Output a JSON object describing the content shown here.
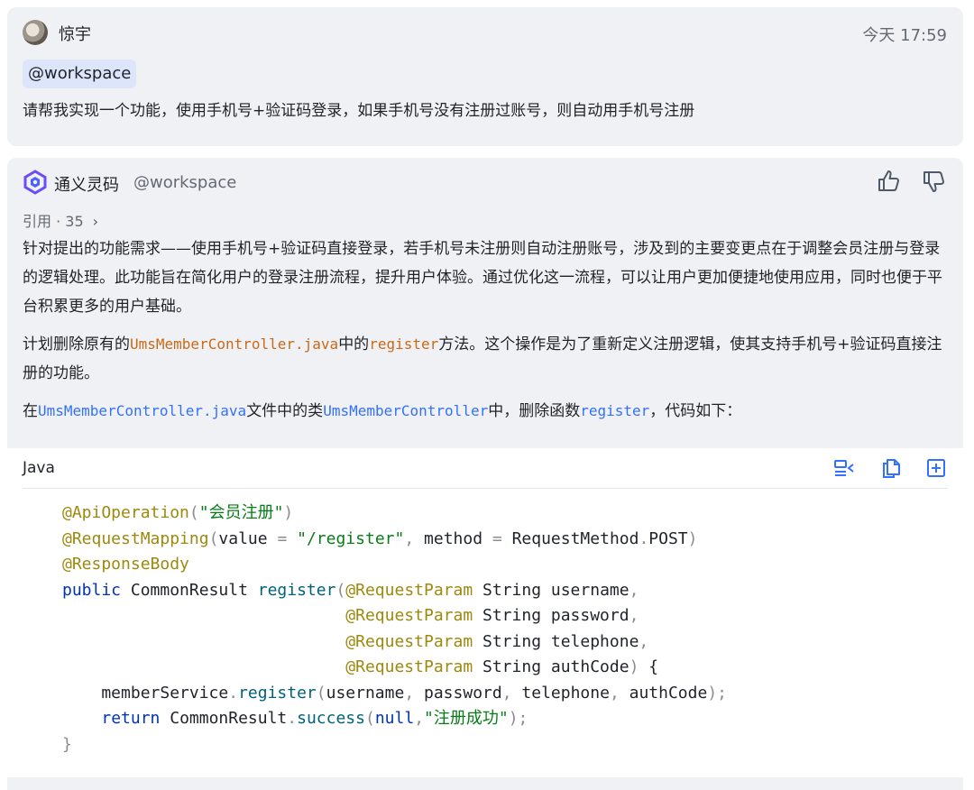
{
  "user_message": {
    "username": "惊宇",
    "time": "今天 17:59",
    "mention": "@workspace",
    "text": "请帮我实现一个功能，使用手机号+验证码登录，如果手机号没有注册过账号，则自动用手机号注册"
  },
  "ai_message": {
    "name": "通义灵码",
    "mention": "@workspace",
    "references": "引用 · 35",
    "paragraph1": "针对提出的功能需求——使用手机号+验证码直接登录，若手机号未注册则自动注册账号，涉及到的主要变更点在于调整会员注册与登录的逻辑处理。此功能旨在简化用户的登录注册流程，提升用户体验。通过优化这一流程，可以让用户更加便捷地使用应用，同时也便于平台积累更多的用户基础。",
    "paragraph2": {
      "t1": "计划删除原有的",
      "c1": "UmsMemberController.java",
      "t2": "中的",
      "c2": "register",
      "t3": "方法。这个操作是为了重新定义注册逻辑，使其支持手机号+验证码直接注册的功能。"
    },
    "paragraph3": {
      "t1": "在",
      "c1": "UmsMemberController.java",
      "t2": "文件中的类",
      "c2": "UmsMemberController",
      "t3": "中，删除函数",
      "c3": "register",
      "t4": "，代码如下："
    },
    "code_block": {
      "language": "Java",
      "lines": [
        "@ApiOperation(\"会员注册\")",
        "@RequestMapping(value = \"/register\", method = RequestMethod.POST)",
        "@ResponseBody",
        "public CommonResult register(@RequestParam String username,",
        "                            @RequestParam String password,",
        "                            @RequestParam String telephone,",
        "                            @RequestParam String authCode) {",
        "    memberService.register(username, password, telephone, authCode);",
        "    return CommonResult.success(null,\"注册成功\");",
        "}"
      ]
    }
  },
  "icons": {
    "avatar": "avatar",
    "ai_logo": "tongyi-logo-icon",
    "like": "thumbs-up-icon",
    "dislike": "thumbs-down-icon",
    "refs_chevron": "chevron-right-icon",
    "toolbar": [
      "diff-apply-icon",
      "copy-icon",
      "insert-icon"
    ]
  },
  "colors": {
    "card_bg": "#f0f1f4",
    "mention_chip_bg": "#dde5fb",
    "inline_code_orange": "#c96a18",
    "inline_code_blue": "#3370ff",
    "accent": "#3370ff"
  }
}
